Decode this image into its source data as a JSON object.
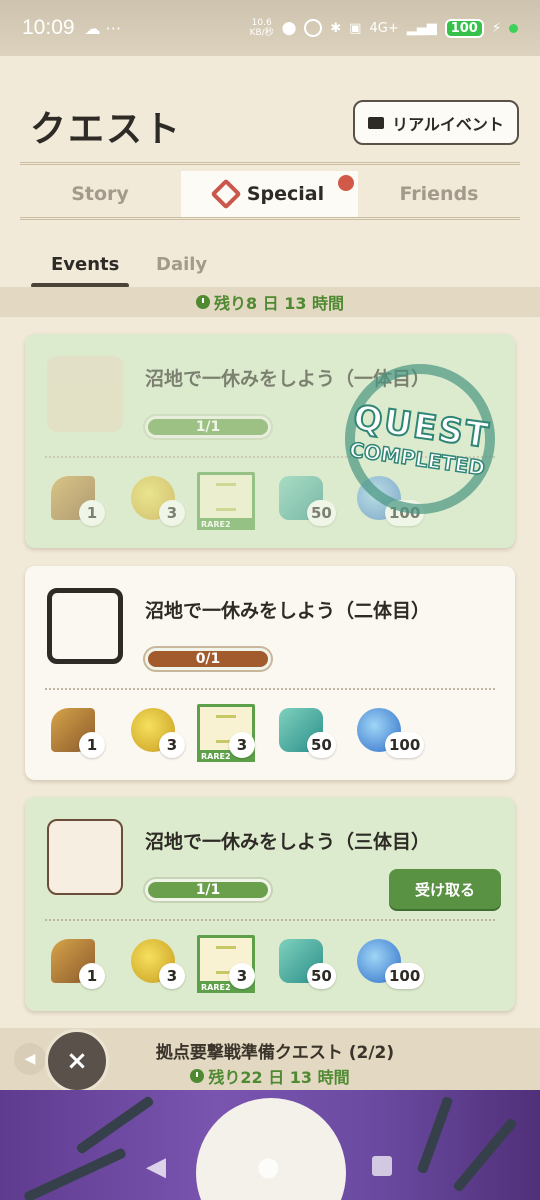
{
  "status_bar": {
    "time": "10:09",
    "net_speed": "10.6\nKB/秒",
    "battery": "100",
    "signal": "4G+"
  },
  "header": {
    "title": "クエスト",
    "event_button_label": "リアルイベント"
  },
  "main_tabs": [
    {
      "label": "Story",
      "active": false
    },
    {
      "label": "Special",
      "active": true,
      "badge": true
    },
    {
      "label": "Friends",
      "active": false
    }
  ],
  "sub_tabs": [
    {
      "label": "Events",
      "active": true
    },
    {
      "label": "Daily",
      "active": false
    }
  ],
  "timer": {
    "remaining": "残り8 日 13 時間"
  },
  "quests": [
    {
      "title": "沼地で一休みをしよう（一体目）",
      "progress": "1/1",
      "progress_fraction": 1.0,
      "state": "completed",
      "stamp_line1": "QUEST",
      "stamp_line2": "COMPLETED",
      "rewards": [
        "1",
        "3",
        "",
        "50",
        "100"
      ],
      "map_rarity": "RARE2"
    },
    {
      "title": "沼地で一休みをしよう（二体目）",
      "progress": "0/1",
      "progress_fraction": 0.0,
      "state": "in-progress",
      "rewards": [
        "1",
        "3",
        "3",
        "50",
        "100"
      ],
      "map_rarity": "RARE2"
    },
    {
      "title": "沼地で一休みをしよう（三体目）",
      "progress": "1/1",
      "progress_fraction": 1.0,
      "state": "claimable",
      "claim_label": "受け取る",
      "rewards": [
        "1",
        "3",
        "3",
        "50",
        "100"
      ],
      "map_rarity": "RARE2"
    }
  ],
  "bottom_banner": {
    "title": "拠点要撃戦準備クエスト (2/2)",
    "remaining": "残り22 日 13 時間",
    "close_label": "×",
    "arrow_label": "◀"
  },
  "colors": {
    "accent_green": "#5a9243",
    "accent_red": "#d05a47",
    "background": "#f2ead9",
    "timer_text": "#4f8a33"
  },
  "icons": {
    "rewards": [
      "telescope-icon",
      "zenny-medal-icon",
      "map-icon",
      "gem-icon",
      "orb-icon"
    ]
  }
}
